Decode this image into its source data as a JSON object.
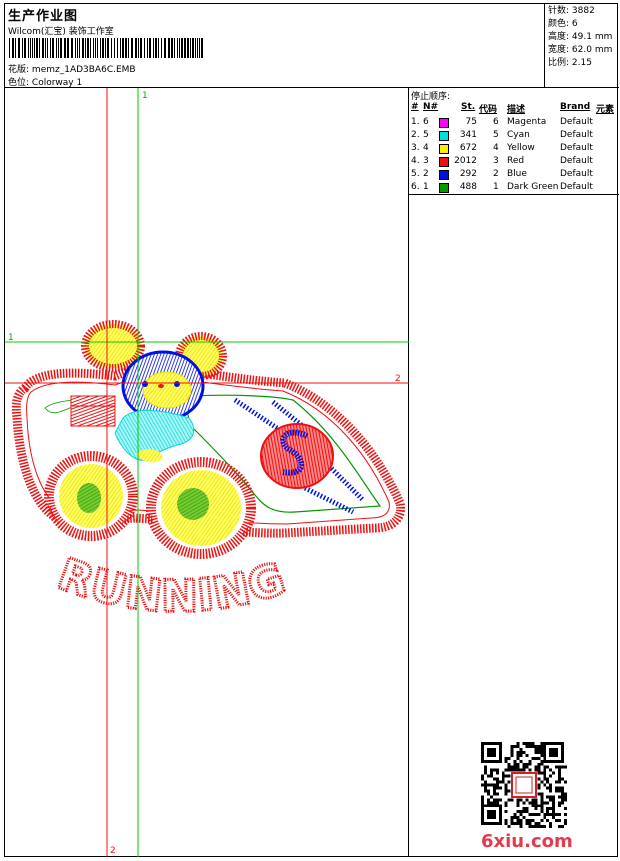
{
  "header": {
    "title": "生产作业图",
    "studio": "Wilcom(汇宝) 装饰工作室",
    "design_label": "花版:",
    "design_file": "memz_1AD3BA6C.EMB",
    "color_label": "色位:",
    "colorway": "Colorway 1"
  },
  "stats": [
    {
      "label": "针数",
      "value": "3882"
    },
    {
      "label": "颜色",
      "value": "6"
    },
    {
      "label": "高度",
      "value": "49.1 mm"
    },
    {
      "label": "宽度",
      "value": "62.0 mm"
    },
    {
      "label": "比例",
      "value": "2.15"
    }
  ],
  "stop_sequence": {
    "title": "停止顺序:",
    "headers": [
      "#",
      "N#",
      "St.",
      "代码",
      "描述",
      "Brand",
      "元素"
    ],
    "rows": [
      {
        "stop": "1.",
        "needle": "6",
        "color": "#ff00ff",
        "stitches": "75",
        "code": "6",
        "desc": "Magenta",
        "brand": "Default"
      },
      {
        "stop": "2.",
        "needle": "5",
        "color": "#00e0e0",
        "stitches": "341",
        "code": "5",
        "desc": "Cyan",
        "brand": "Default"
      },
      {
        "stop": "3.",
        "needle": "4",
        "color": "#ffee00",
        "stitches": "672",
        "code": "4",
        "desc": "Yellow",
        "brand": "Default"
      },
      {
        "stop": "4.",
        "needle": "3",
        "color": "#ee1111",
        "stitches": "2012",
        "code": "3",
        "desc": "Red",
        "brand": "Default"
      },
      {
        "stop": "5.",
        "needle": "2",
        "color": "#0011dd",
        "stitches": "292",
        "code": "2",
        "desc": "Blue",
        "brand": "Default"
      },
      {
        "stop": "6.",
        "needle": "1",
        "color": "#009900",
        "stitches": "488",
        "code": "1",
        "desc": "Dark Green",
        "brand": "Default"
      }
    ]
  },
  "guides": {
    "h1": "1",
    "h2": "2",
    "v1": "1",
    "v2": "2"
  },
  "artwork": {
    "text": "RUNNING"
  },
  "watermark": "6xiu.com",
  "colors": {
    "red": "#ee1111",
    "green": "#00cc00",
    "blue": "#0011dd",
    "yellow": "#ffee00",
    "cyan": "#00e0e0",
    "dark_green": "#009900"
  }
}
